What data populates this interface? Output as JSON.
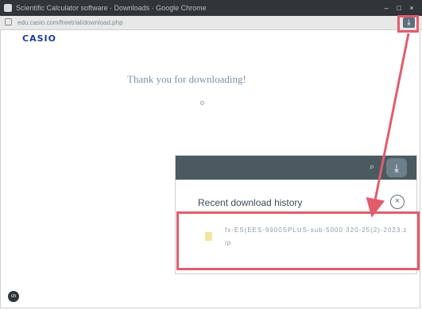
{
  "titlebar": {
    "title": "Scientific Calculator software  ·  Downloads  ·  Google Chrome",
    "minimize": "–",
    "maximize": "□",
    "close": "×"
  },
  "addressbar": {
    "url": "edu.casio.com/freetrial/download.php"
  },
  "toolbar": {
    "download_button_icon": "download-icon"
  },
  "page": {
    "logo": "CASIO",
    "heading": "Thank you for downloading!"
  },
  "download_panel": {
    "search_icon": "⌕",
    "download_icon": "⤓",
    "title": "Recent download history",
    "close_label": "×",
    "items": [
      {
        "file_name": "fx-ES(EES-9900SPLUS-sub-5000 320-25(2)-2023.zip"
      }
    ]
  },
  "badge": "ch",
  "colors": {
    "titlebar": "#2f3539",
    "panel_header": "#4b5a61",
    "highlight": "#e15d6d",
    "logo": "#1e3d8f"
  }
}
